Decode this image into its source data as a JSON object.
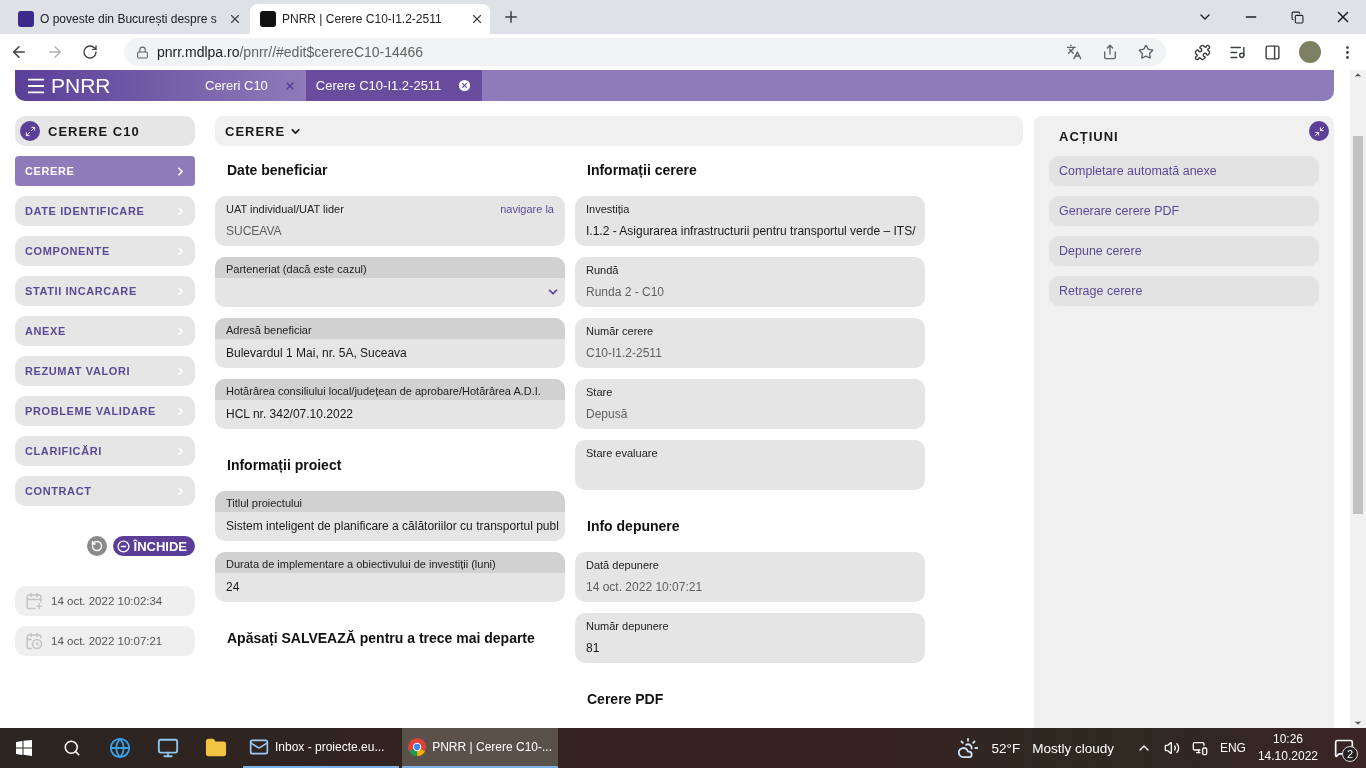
{
  "browser": {
    "tabs": [
      {
        "title": "O poveste din București despre s",
        "selected": false
      },
      {
        "title": "PNRR | Cerere C10-I1.2-2511",
        "selected": true
      }
    ],
    "url_host": "pnrr.mdlpa.ro",
    "url_path": "/pnrr//#edit$cerereC10-14466"
  },
  "app": {
    "logo": "PNRR",
    "tabs": [
      {
        "label": "Cereri C10",
        "selected": false
      },
      {
        "label": "Cerere C10-I1.2-2511",
        "selected": true
      }
    ]
  },
  "sidebar": {
    "title": "CERERE C10",
    "items": [
      {
        "label": "CERERE",
        "selected": true
      },
      {
        "label": "DATE IDENTIFICARE",
        "selected": false
      },
      {
        "label": "COMPONENTE",
        "selected": false
      },
      {
        "label": "STATII INCARCARE",
        "selected": false
      },
      {
        "label": "ANEXE",
        "selected": false
      },
      {
        "label": "REZUMAT VALORI",
        "selected": false
      },
      {
        "label": "PROBLEME VALIDARE",
        "selected": false
      },
      {
        "label": "CLARIFICĂRI",
        "selected": false
      },
      {
        "label": "CONTRACT",
        "selected": false
      }
    ],
    "close_button": "ÎNCHIDE",
    "dates": [
      {
        "kind": "created",
        "text": "14 oct. 2022 10:02:34"
      },
      {
        "kind": "modified",
        "text": "14 oct. 2022 10:07:21"
      }
    ]
  },
  "form": {
    "title": "CERERE",
    "columns": [
      [
        {
          "title": "Date beneficiar",
          "fields": [
            {
              "label": "UAT individual/UAT lider",
              "kind": "display",
              "value": "SUCEAVA",
              "muted": true,
              "link": "navigare la"
            },
            {
              "label": "Parteneriat (dacă este cazul)",
              "kind": "select"
            },
            {
              "label": "Adresă beneficiar",
              "kind": "input",
              "value": "Bulevardul 1 Mai, nr. 5A, Suceava",
              "muted": false
            },
            {
              "label": "Hotărârea consiliului local/județean de aprobare/Hotărârea A.D.I.",
              "kind": "input",
              "value": "HCL nr. 342/07.10.2022",
              "muted": false
            }
          ]
        },
        {
          "title": "Informații proiect",
          "fields": [
            {
              "label": "Titlul proiectului",
              "kind": "input",
              "value": "Sistem inteligent de planificare a călătoriilor cu transportul publ",
              "muted": false
            },
            {
              "label": "Durata de implementare a obiectivului de investiții (luni)",
              "kind": "input",
              "value": "24",
              "muted": false
            }
          ]
        },
        {
          "title": "Apăsați SALVEAZĂ pentru a trece mai departe"
        }
      ],
      [
        {
          "title": "Informații cerere",
          "fields": [
            {
              "label": "Investiția",
              "kind": "display",
              "value": "I.1.2 - Asigurarea infrastructurii pentru transportul verde – ITS/",
              "muted": false
            },
            {
              "label": "Rundă",
              "kind": "display",
              "value": "Runda 2 - C10",
              "muted": true
            },
            {
              "label": "Număr cerere",
              "kind": "display",
              "value": "C10-I1.2-2511",
              "muted": true
            },
            {
              "label": "Stare",
              "kind": "display",
              "value": "Depusă",
              "muted": true
            },
            {
              "label": "Stare evaluare",
              "kind": "display"
            }
          ]
        },
        {
          "title": "Info depunere",
          "fields": [
            {
              "label": "Dată depunere",
              "kind": "display",
              "value": "14 oct. 2022 10:07:21",
              "muted": true
            },
            {
              "label": "Număr depunere",
              "kind": "display",
              "value": "81",
              "muted": false
            }
          ]
        },
        {
          "title": "Cerere PDF"
        }
      ]
    ]
  },
  "actions": {
    "title": "ACȚIUNI",
    "items": [
      "Completare automată anexe",
      "Generare cerere PDF",
      "Depune cerere",
      "Retrage cerere"
    ]
  },
  "taskbar": {
    "apps": [
      {
        "kind": "mail",
        "label": "Inbox - proiecte.eu...",
        "selected": false
      },
      {
        "kind": "browser",
        "label": "PNRR | Cerere C10-...",
        "selected": true
      }
    ],
    "temperature": "52°F",
    "weather": "Mostly cloudy",
    "language": "ENG",
    "time": "10:26",
    "date": "14.10.2022",
    "notifications": "2"
  }
}
